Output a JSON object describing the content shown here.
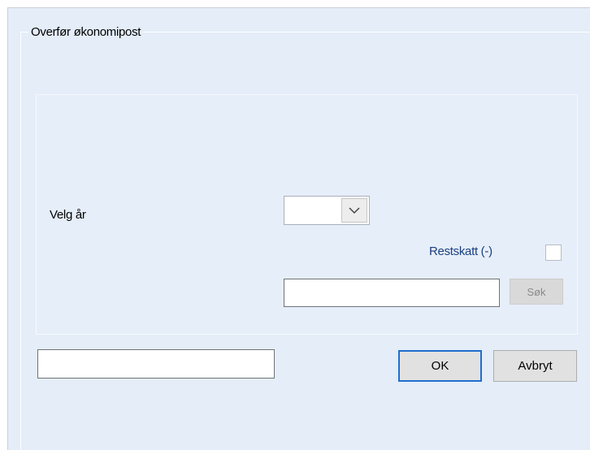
{
  "dialog": {
    "group_title": "Overfør økonomipost"
  },
  "form": {
    "year_label": "Velg år",
    "year_value": "",
    "year_dropdown_icon": "chevron-down-icon",
    "restskatt_label": "Restskatt (-)",
    "restskatt_checked": false,
    "search_value": "",
    "search_button_label": "Søk",
    "bottom_field_value": ""
  },
  "buttons": {
    "ok_label": "OK",
    "cancel_label": "Avbryt"
  },
  "colors": {
    "background": "#e4edf8",
    "restskatt_label": "#1b3f80",
    "ok_focus_border": "#1f6fd0"
  }
}
